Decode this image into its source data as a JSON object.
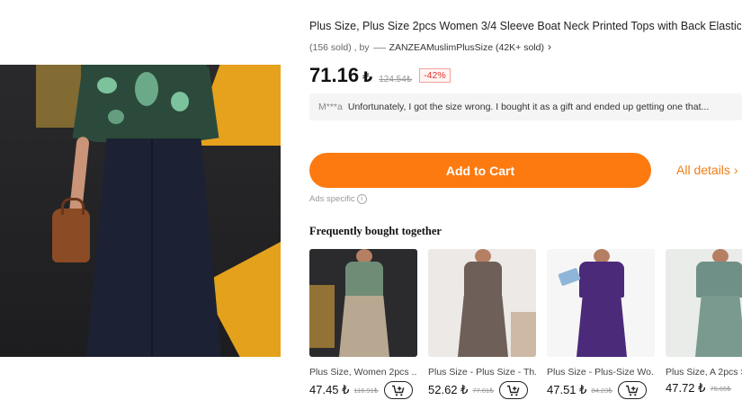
{
  "product": {
    "title": "Plus Size, Plus Size 2pcs Women 3/4 Sleeve Boat Neck Printed Tops with Back Elastic",
    "sold": "(156 sold) , by",
    "store": "ZANZEAMuslimPlusSize (42K+ sold)",
    "price": "71.16",
    "currency": "₺",
    "old_price": "124.54₺",
    "discount": "-42%"
  },
  "review": {
    "reviewer": "M***a",
    "text": "Unfortunately, I got the size wrong. I bought it as a gift and ended up getting one that..."
  },
  "actions": {
    "add_to_cart": "Add to Cart",
    "all_details": "All details",
    "ads_label": "Ads specific"
  },
  "fbt": {
    "title": "Frequently bought together",
    "items": [
      {
        "name": "Plus Size, Women 2pcs ...",
        "price": "47.45 ₺",
        "old_price": "116.91₺"
      },
      {
        "name": "Plus Size - Plus Size - Th...",
        "price": "52.62 ₺",
        "old_price": "77.01₺"
      },
      {
        "name": "Plus Size - Plus-Size Wo...",
        "price": "47.51 ₺",
        "old_price": "84.23₺"
      },
      {
        "name": "Plus Size, A 2pcs S",
        "price": "47.72 ₺",
        "old_price": "75.65₺"
      }
    ]
  },
  "colors": {
    "accent": "#fd7a10",
    "discount_red": "#e0322c",
    "link_orange": "#f07e17"
  },
  "icons": {
    "store_chevron": "chevron-right-icon",
    "details_chevron": "chevron-right-icon",
    "ads_info": "info-icon",
    "mini_cart": "add-to-cart-icon"
  }
}
